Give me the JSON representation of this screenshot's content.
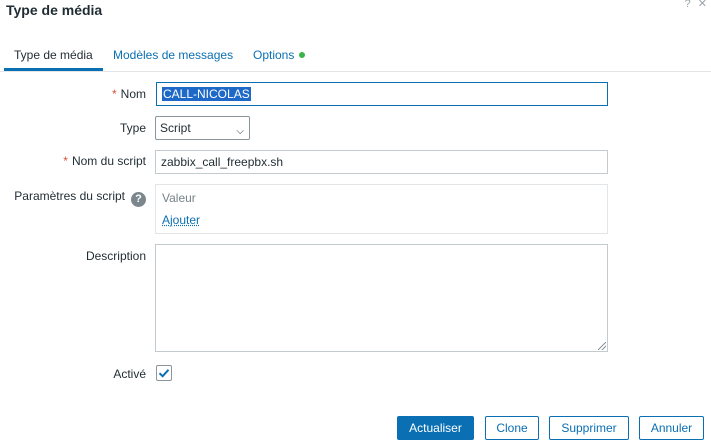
{
  "dialog": {
    "title": "Type de média"
  },
  "tabs": [
    {
      "label": "Type de média",
      "active": true
    },
    {
      "label": "Modèles de messages",
      "active": false
    },
    {
      "label": "Options",
      "active": false,
      "indicator_color": "#3cb44b"
    }
  ],
  "form": {
    "name": {
      "label": "Nom",
      "required": true,
      "value": "CALL-NICOLAS"
    },
    "type": {
      "label": "Type",
      "selected": "Script"
    },
    "script_name": {
      "label": "Nom du script",
      "required": true,
      "value": "zabbix_call_freepbx.sh"
    },
    "script_params": {
      "label": "Paramètres du script",
      "header": "Valeur",
      "add_label": "Ajouter"
    },
    "description": {
      "label": "Description",
      "value": ""
    },
    "enabled": {
      "label": "Activé",
      "checked": true
    }
  },
  "buttons": {
    "update": "Actualiser",
    "clone": "Clone",
    "delete": "Supprimer",
    "cancel": "Annuler"
  },
  "colors": {
    "accent": "#0b6fb3",
    "required": "#d8503a",
    "selection": "#1e68c8"
  }
}
